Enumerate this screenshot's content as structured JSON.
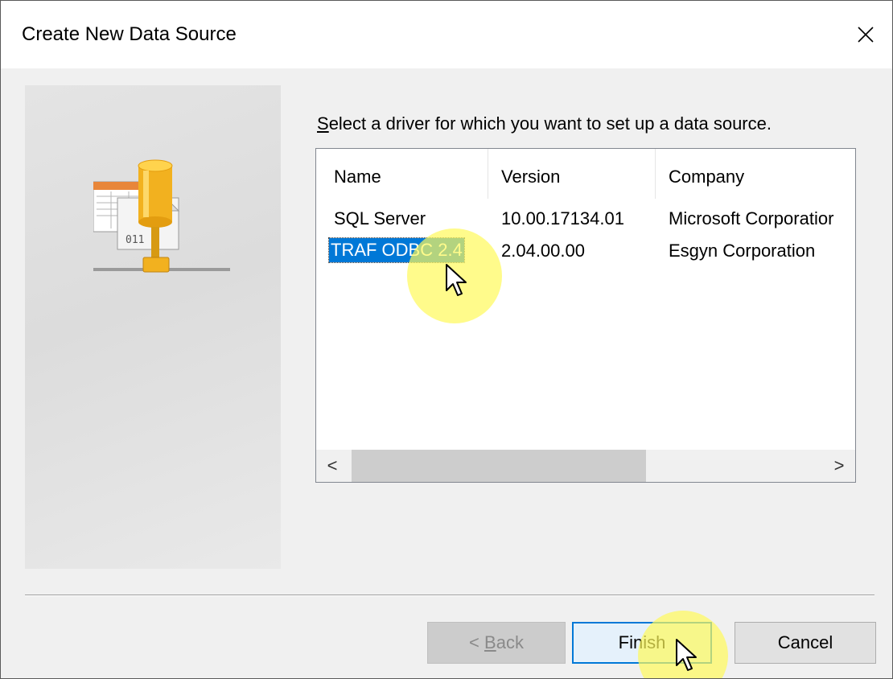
{
  "window": {
    "title": "Create New Data Source",
    "close_glyph": "✕"
  },
  "instruction": {
    "mnemonic": "S",
    "rest": "elect a driver for which you want to set up a data source."
  },
  "drivers": {
    "columns": [
      "Name",
      "Version",
      "Company"
    ],
    "rows": [
      {
        "name": "SQL Server",
        "version": "10.00.17134.01",
        "company": "Microsoft Corporatior",
        "selected": false
      },
      {
        "name": "TRAF ODBC 2.4",
        "version": "2.04.00.00",
        "company": "Esgyn Corporation",
        "selected": true
      }
    ]
  },
  "scrollbar": {
    "left_arrow": "<",
    "right_arrow": ">"
  },
  "buttons": {
    "back": {
      "prefix": "< ",
      "mnemonic": "B",
      "rest": "ack",
      "enabled": false
    },
    "finish": {
      "label": "Finish",
      "default": true
    },
    "cancel": {
      "label": "Cancel"
    }
  },
  "colors": {
    "selection": "#0078d7",
    "click_highlight": "#fffa5a",
    "dialog_bg": "#f0f0f0"
  },
  "icons": [
    "close-icon",
    "odbc-data-source-icon",
    "mouse-cursor-icon"
  ]
}
